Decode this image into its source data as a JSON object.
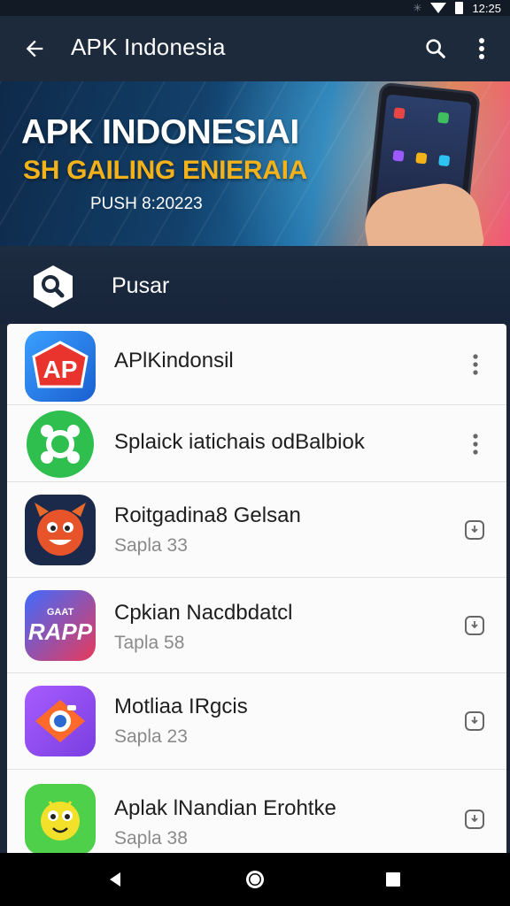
{
  "status_bar": {
    "time": "12:25",
    "icons": [
      "signal-icon",
      "wifi-icon",
      "battery-icon"
    ]
  },
  "app_bar": {
    "title": "APK Indonesia",
    "back_icon": "arrow-back-icon",
    "search_icon": "search-icon",
    "more_icon": "more-vert-icon"
  },
  "banner": {
    "headline": "APK INDONESIAI",
    "subline": "SH GAILING ENIERAIA",
    "pushline": "PUSH 8:20223"
  },
  "search_row": {
    "icon": "search-icon",
    "label": "Pusar"
  },
  "apps": [
    {
      "name": "APlKindonsil",
      "sub": "",
      "icon": "ap-logo-icon",
      "action": "more-vert-icon"
    },
    {
      "name": "Splaick iatichais odBalbiok",
      "sub": "",
      "icon": "green-ring-icon",
      "action": "more-vert-icon"
    },
    {
      "name": "Roitgadina8 Gelsan",
      "sub": "Sapla 33",
      "icon": "devil-mascot-icon",
      "action": "download-icon"
    },
    {
      "name": "Cpkian Nacdbdatcl",
      "sub": "Tapla 58",
      "icon": "rapp-logo-icon",
      "action": "download-icon"
    },
    {
      "name": "Motliaa IRgcis",
      "sub": "Sapla 23",
      "icon": "camera-app-icon",
      "action": "download-icon"
    },
    {
      "name": "Aplak lNandian Erohtke",
      "sub": "Sapla 38",
      "icon": "green-mascot-icon",
      "action": "download-icon"
    }
  ],
  "colors": {
    "app_bar_bg": "#1d2a3b",
    "banner_accent": "#f3b21a",
    "list_bg": "#fbfbfb"
  },
  "nav_bar": {
    "buttons": [
      "back-triangle-icon",
      "home-circle-icon",
      "recents-square-icon"
    ]
  }
}
